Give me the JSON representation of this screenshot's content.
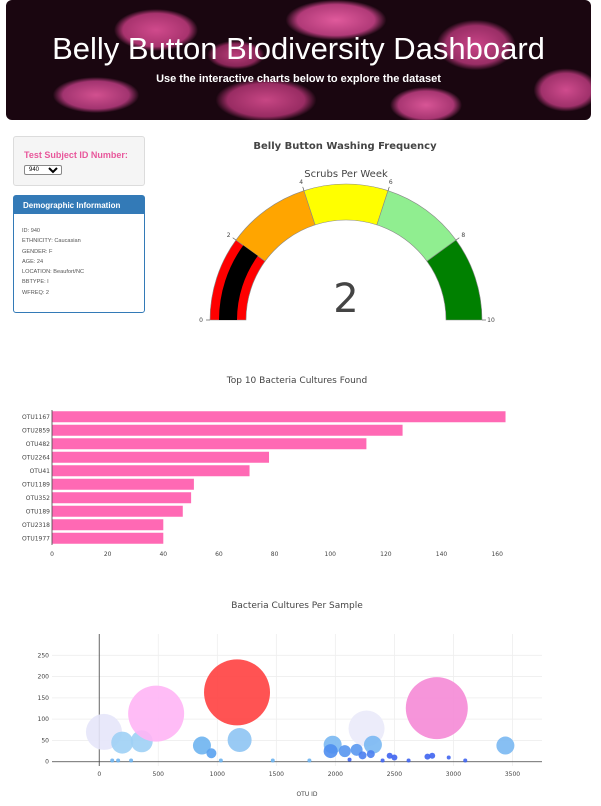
{
  "header": {
    "title": "Belly Button Biodiversity Dashboard",
    "subtitle": "Use the interactive charts below to explore the dataset"
  },
  "selector": {
    "label": "Test Subject ID Number:",
    "selected": "940",
    "options": [
      "940"
    ]
  },
  "demographics": {
    "title": "Demographic Information",
    "rows": [
      "ID: 940",
      "ETHNICITY: Caucasian",
      "GENDER: F",
      "AGE: 24",
      "LOCATION: Beaufort/NC",
      "BBTYPE: I",
      "WFREQ: 2"
    ]
  },
  "colors": {
    "accent_pink": "#e8579b",
    "panel_blue": "#337ab7",
    "bar_pink": "#ff69b4"
  },
  "chart_data": [
    {
      "type": "gauge",
      "title": "Belly Button Washing Frequency",
      "subtitle": "Scrubs Per Week",
      "value": 2,
      "value_label": "2",
      "range": [
        0,
        10
      ],
      "ticks": [
        "0",
        "2",
        "4",
        "6",
        "8",
        "10"
      ],
      "bands": [
        {
          "from": 0,
          "to": 2,
          "color": "#ff0000"
        },
        {
          "from": 2,
          "to": 4,
          "color": "#ffa500"
        },
        {
          "from": 4,
          "to": 6,
          "color": "#ffff00"
        },
        {
          "from": 6,
          "to": 8,
          "color": "#90ee90"
        },
        {
          "from": 8,
          "to": 10,
          "color": "#008000"
        }
      ],
      "bar_color": "#000000"
    },
    {
      "type": "bar",
      "orientation": "horizontal",
      "title": "Top 10 Bacteria Cultures Found",
      "categories": [
        "OTU1167",
        "OTU2859",
        "OTU482",
        "OTU2264",
        "OTU41",
        "OTU1189",
        "OTU352",
        "OTU189",
        "OTU2318",
        "OTU1977"
      ],
      "values": [
        163,
        126,
        113,
        78,
        71,
        51,
        50,
        47,
        40,
        40
      ],
      "xlim": [
        0,
        170
      ],
      "xticks": [
        "0",
        "20",
        "40",
        "60",
        "80",
        "100",
        "120",
        "140",
        "160"
      ],
      "color": "#ff69b4"
    },
    {
      "type": "scatter",
      "title": "Bacteria Cultures Per Sample",
      "xlabel": "OTU ID",
      "xlim": [
        -400,
        3750
      ],
      "ylim": [
        -10,
        300
      ],
      "xticks": [
        "0",
        "500",
        "1000",
        "1500",
        "2000",
        "2500",
        "3000",
        "3500"
      ],
      "yticks": [
        "0",
        "50",
        "100",
        "150",
        "200",
        "250"
      ],
      "points": [
        {
          "x": 40,
          "y": 70,
          "r": 18,
          "color": "#e5e5fa"
        },
        {
          "x": 195,
          "y": 45,
          "r": 11,
          "color": "#9fd0f5"
        },
        {
          "x": 360,
          "y": 48,
          "r": 11,
          "color": "#9fd0f5"
        },
        {
          "x": 482,
          "y": 113,
          "r": 28,
          "color": "#ffb5f5"
        },
        {
          "x": 1167,
          "y": 163,
          "r": 33,
          "color": "#ff4040"
        },
        {
          "x": 2859,
          "y": 126,
          "r": 31,
          "color": "#f58ad6"
        },
        {
          "x": 2264,
          "y": 78,
          "r": 18,
          "color": "#eaeafa"
        },
        {
          "x": 870,
          "y": 38,
          "r": 9,
          "color": "#6eb4f0"
        },
        {
          "x": 950,
          "y": 20,
          "r": 5,
          "color": "#5aa2f0"
        },
        {
          "x": 1189,
          "y": 51,
          "r": 12,
          "color": "#8ec4f3"
        },
        {
          "x": 1977,
          "y": 40,
          "r": 9,
          "color": "#7ab8f2"
        },
        {
          "x": 1960,
          "y": 25,
          "r": 7,
          "color": "#4f8ef0"
        },
        {
          "x": 2080,
          "y": 25,
          "r": 6,
          "color": "#5896ef"
        },
        {
          "x": 2180,
          "y": 28,
          "r": 6,
          "color": "#5a98f0"
        },
        {
          "x": 2318,
          "y": 40,
          "r": 9,
          "color": "#7ab8f2"
        },
        {
          "x": 2230,
          "y": 15,
          "r": 4,
          "color": "#4b7ff0"
        },
        {
          "x": 2300,
          "y": 18,
          "r": 4,
          "color": "#4b7ff0"
        },
        {
          "x": 2500,
          "y": 10,
          "r": 3,
          "color": "#3f64f0"
        },
        {
          "x": 2460,
          "y": 14,
          "r": 3,
          "color": "#3f64f0"
        },
        {
          "x": 2780,
          "y": 12,
          "r": 3,
          "color": "#3f64f0"
        },
        {
          "x": 2820,
          "y": 14,
          "r": 3,
          "color": "#3f64f0"
        },
        {
          "x": 2960,
          "y": 10,
          "r": 2,
          "color": "#3f64f0"
        },
        {
          "x": 3440,
          "y": 38,
          "r": 9,
          "color": "#7ab8f2"
        },
        {
          "x": 110,
          "y": 3,
          "r": 2,
          "color": "#6eb4f0"
        },
        {
          "x": 160,
          "y": 3,
          "r": 2,
          "color": "#6eb4f0"
        },
        {
          "x": 270,
          "y": 3,
          "r": 2,
          "color": "#6eb4f0"
        },
        {
          "x": 1030,
          "y": 3,
          "r": 2,
          "color": "#6eb4f0"
        },
        {
          "x": 1470,
          "y": 3,
          "r": 2,
          "color": "#6eb4f0"
        },
        {
          "x": 1780,
          "y": 3,
          "r": 2,
          "color": "#6eb4f0"
        },
        {
          "x": 2120,
          "y": 5,
          "r": 2,
          "color": "#3f64f0"
        },
        {
          "x": 2400,
          "y": 3,
          "r": 2,
          "color": "#3f64f0"
        },
        {
          "x": 2620,
          "y": 3,
          "r": 2,
          "color": "#3f64f0"
        },
        {
          "x": 3100,
          "y": 3,
          "r": 2,
          "color": "#3f64f0"
        }
      ]
    }
  ]
}
